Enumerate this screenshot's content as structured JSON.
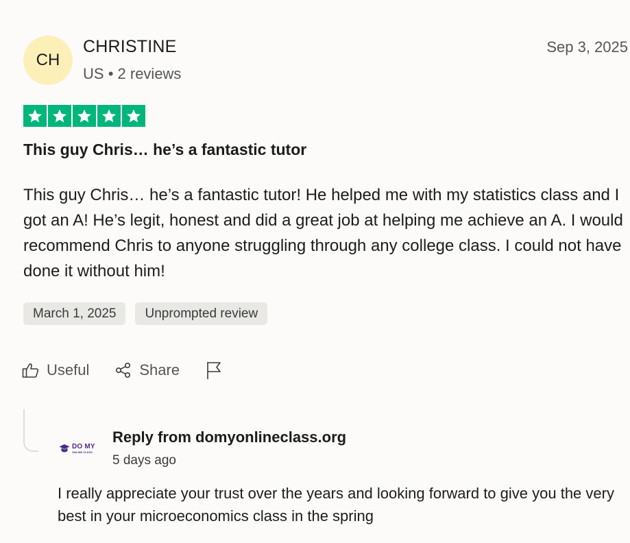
{
  "reviewer": {
    "initials": "CH",
    "name": "CHRISTINE",
    "country": "US",
    "separator": "•",
    "review_count": "2 reviews"
  },
  "review": {
    "date": "Sep 3, 2025",
    "rating": 5,
    "star_color": "#00b67a",
    "title": "This guy Chris… he’s a fantastic tutor",
    "body": "This guy Chris… he’s a fantastic tutor! He helped me with my statistics class and I got an A! He’s legit, honest and did a great job at helping me achieve an A. I would recommend Chris to anyone struggling through any college class. I could not have done it without him!",
    "tags": [
      "March 1, 2025",
      "Unprompted review"
    ]
  },
  "actions": {
    "useful_label": "Useful",
    "share_label": "Share",
    "useful_icon": "thumbs-up-icon",
    "share_icon": "share-icon",
    "report_icon": "flag-icon"
  },
  "reply": {
    "logo_text": "DO MY",
    "logo_subtext": "ONLINE CLASS",
    "from": "Reply from domyonlineclass.org",
    "date": "5 days ago",
    "body": "I really appreciate your trust over the years and looking forward to give you the very best in your microeconomics class in the spring"
  }
}
